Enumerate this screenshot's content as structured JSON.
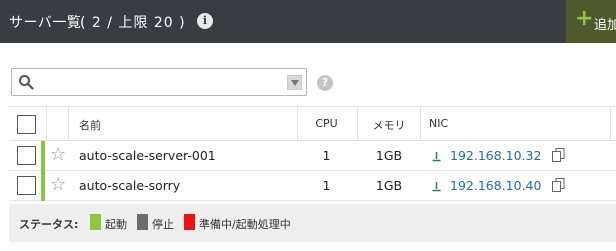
{
  "header": {
    "title": "サーバ一覧",
    "count": "( 2 / 上限 20 )",
    "info_icon": "info-circle-icon",
    "add_label": "追加",
    "add_icon": "plus-icon",
    "background": "#383d41",
    "accent": "#8dc63f"
  },
  "search": {
    "value": "",
    "placeholder": "",
    "icon": "search-icon",
    "dropdown_icon": "dropdown-arrow-icon",
    "help_icon": "question-circle-icon"
  },
  "table": {
    "columns": [
      "名前",
      "CPU",
      "メモリ",
      "NIC"
    ],
    "rows": [
      {
        "name": "auto-scale-server-001",
        "cpu": "1",
        "memory": "1GB",
        "ip": "192.168.10.32",
        "status_color": "#8dc63f"
      },
      {
        "name": "auto-scale-sorry",
        "cpu": "1",
        "memory": "1GB",
        "ip": "192.168.10.40",
        "status_color": "#8dc63f"
      }
    ]
  },
  "legend": {
    "title": "ステータス:",
    "items": [
      {
        "label": "起動",
        "color": "#8dc63f"
      },
      {
        "label": "停止",
        "color": "#6d6d6d"
      },
      {
        "label": "準備中/起動処理中",
        "color": "#ee1111"
      }
    ]
  }
}
